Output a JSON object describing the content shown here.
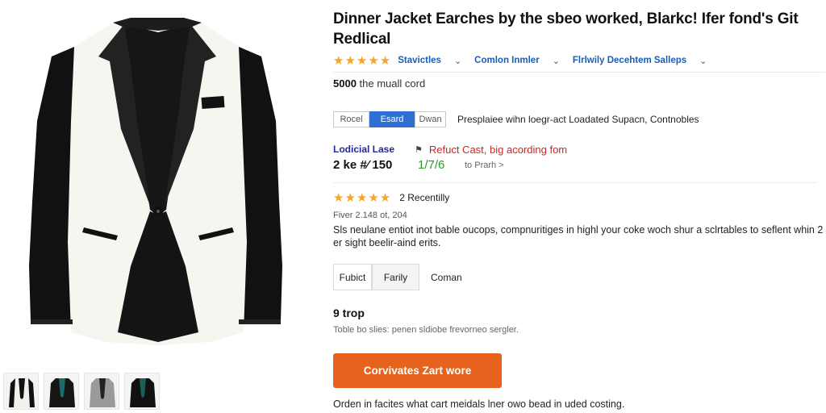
{
  "product": {
    "title": "Dinner Jacket Earches by the sbeo worked, Blarkc! Ifer fond's Git Redlical",
    "rating_stars": "★★★★★",
    "rating_links": [
      "Stavictles",
      "Comlon Inmler",
      "Flrlwily Decehtem Salleps"
    ],
    "price_value": "5000",
    "price_text": "the muall cord"
  },
  "segments": {
    "items": [
      "Rocel",
      "Esard",
      "Dwan"
    ],
    "active_index": 1,
    "description": "Presplaiee wihn loegr-act Loadated Supacn, Contnobles"
  },
  "pricing": {
    "label": "Lodicial Lase",
    "value": "2 ke #⁄ 150",
    "alert_icon": "flag-icon",
    "alert_text": "Refuct Cast, big acording fom",
    "green_value": "1/7/6",
    "link_text": "to Prarh >"
  },
  "reviews": {
    "stars": "★★★★★",
    "count_text": "2 Recentilly",
    "sub_text": "Fiver 2.148 ot, 204",
    "description": "Sls neulane entiot inot bable oucops, compnuritiges in highl your coke woch shur a sclrtables to seflent whin 2 er sight beelir-aind erits."
  },
  "options": {
    "items": [
      "Fubict",
      "Farily"
    ],
    "plain": "Coman"
  },
  "trop": {
    "title": "9 trop",
    "subtitle": "Toble bo slies: penen sldiobe frevorneo sergler."
  },
  "cta": {
    "label": "Corvivates Zart wore"
  },
  "footer": {
    "text": "Orden in facites what cart meidals lner owo bead in uded costing."
  },
  "colors": {
    "accent_blue": "#2f6fd1",
    "cta_orange": "#e5631d",
    "star_gold": "#f5a623",
    "alert_red": "#d2231e",
    "positive_green": "#2a9a2a"
  }
}
